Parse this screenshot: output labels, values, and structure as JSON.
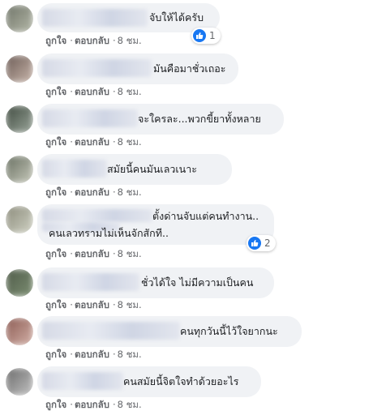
{
  "comments": [
    {
      "text_lines": [
        "จับให้ได้ครับ"
      ],
      "actions": {
        "like": "ถูกใจ",
        "reply": "ตอบกลับ",
        "time": "8 ชม."
      },
      "reactions": {
        "icon": "like-icon",
        "count": "1"
      },
      "avatar_colors": [
        "#6f7468",
        "#b4b8a8"
      ]
    },
    {
      "text_lines": [
        "มันคือมาชั่วเถอะ"
      ],
      "actions": {
        "like": "ถูกใจ",
        "reply": "ตอบกลับ",
        "time": "8 ชม."
      },
      "avatar_colors": [
        "#6b5b55",
        "#c9b6ab"
      ]
    },
    {
      "text_lines": [
        "จะใครละ...พวกขี้ยาทั้งหลาย"
      ],
      "actions": {
        "like": "ถูกใจ",
        "reply": "ตอบกลับ",
        "time": "8 ชม."
      },
      "avatar_colors": [
        "#3f4a3f",
        "#9aa59a"
      ]
    },
    {
      "text_lines": [
        "สมัยนี้คนมันเลวเนาะ"
      ],
      "actions": {
        "like": "ถูกใจ",
        "reply": "ตอบกลับ",
        "time": "8 ชม."
      },
      "avatar_colors": [
        "#676e60",
        "#c7c9bb"
      ]
    },
    {
      "text_lines": [
        "ตั้งด่านจับแต่คนทำงาน..",
        "คนเลวทรามไม่เห็นจักสักที.."
      ],
      "actions": {
        "like": "ถูกใจ",
        "reply": "ตอบกลับ",
        "time": "8 ชม."
      },
      "reactions": {
        "icon": "like-icon",
        "count": "2"
      },
      "avatar_colors": [
        "#8a8a7a",
        "#d0d2c4"
      ]
    },
    {
      "text_lines": [
        "ชั่วได้ใจ ไม่มีความเป็นคน"
      ],
      "actions": {
        "like": "ถูกใจ",
        "reply": "ตอบกลับ",
        "time": "8 ชม."
      },
      "avatar_colors": [
        "#4e5a48",
        "#7d8f73"
      ]
    },
    {
      "text_lines": [
        "คนทุกวันนี้ไว้ใจยากนะ"
      ],
      "actions": {
        "like": "ถูกใจ",
        "reply": "ตอบกลับ",
        "time": "8 ชม."
      },
      "avatar_colors": [
        "#8b5a52",
        "#d3b1a8"
      ]
    },
    {
      "text_lines": [
        "คนสมัยนี้จิตใจทำด้วยอะไร"
      ],
      "actions": {
        "like": "ถูกใจ",
        "reply": "ตอบกลับ",
        "time": "8 ชม."
      },
      "avatar_colors": [
        "#6a6a6a",
        "#c2c2c2"
      ]
    }
  ]
}
